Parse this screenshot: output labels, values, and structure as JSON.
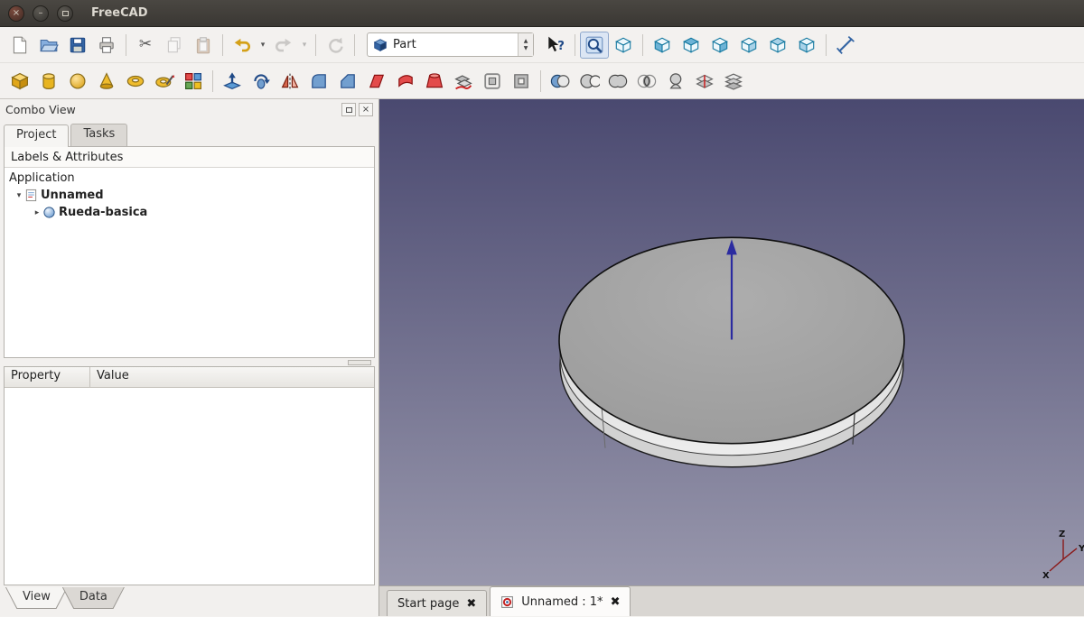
{
  "window": {
    "title": "FreeCAD",
    "controls": [
      "close",
      "minimize",
      "maximize"
    ]
  },
  "toolbar_file": {
    "icons": [
      "new-document",
      "open-document",
      "save-document",
      "print",
      "cut",
      "copy",
      "paste",
      "undo",
      "undo-dropdown",
      "redo",
      "redo-dropdown",
      "refresh"
    ],
    "disabled_icons": [
      "copy",
      "paste",
      "redo",
      "redo-dropdown",
      "refresh"
    ]
  },
  "workbench_selector": {
    "value": "Part",
    "icon": "part-workbench-cube-icon"
  },
  "toolbar_view": {
    "icons": [
      "whats-this",
      "fit-all",
      "axonometric-view",
      "front-view",
      "top-view",
      "right-view",
      "rear-view",
      "bottom-view",
      "left-view",
      "measure-distance"
    ],
    "pressed": [
      "fit-all"
    ]
  },
  "toolbar_part": {
    "icons": [
      "box",
      "cylinder",
      "sphere",
      "cone",
      "torus",
      "create-primitives",
      "shape-builder",
      "extrude",
      "revolve",
      "mirror",
      "fillet",
      "chamfer",
      "make-face",
      "ruled-surface",
      "loft",
      "sweep",
      "offset",
      "thickness",
      "boolean",
      "cut-boolean",
      "union",
      "intersection",
      "section",
      "cross-sections",
      "compound"
    ]
  },
  "combo_view": {
    "title": "Combo View",
    "tabs": [
      {
        "label": "Project",
        "active": true
      },
      {
        "label": "Tasks",
        "active": false
      }
    ],
    "tree_header": "Labels & Attributes",
    "tree": {
      "root_label": "Application",
      "items": [
        {
          "label": "Unnamed",
          "icon": "document-icon",
          "expanded": true
        },
        {
          "label": "Rueda-basica",
          "icon": "part-sphere-icon",
          "expanded": false
        }
      ]
    },
    "property_panel": {
      "columns": [
        "Property",
        "Value"
      ],
      "rows": []
    },
    "bottom_tabs": [
      {
        "label": "View",
        "active": true
      },
      {
        "label": "Data",
        "active": false
      }
    ]
  },
  "viewport": {
    "document_tabs": [
      {
        "label": "Start page",
        "active": false,
        "icon": null
      },
      {
        "label": "Unnamed : 1*",
        "active": true,
        "icon": "freecad-document-icon"
      }
    ],
    "navigation_axes": {
      "x": "X",
      "y": "Y",
      "z": "Z"
    },
    "scene": {
      "object": "Rueda-basica",
      "object_type": "wheel-disc",
      "background_top": "#4a4970",
      "background_bottom": "#9897ac",
      "object_top_color": "#a2a2a2",
      "rim_color": "#e8e8e8",
      "axis_arrow_color": "#2b2ba0"
    }
  }
}
